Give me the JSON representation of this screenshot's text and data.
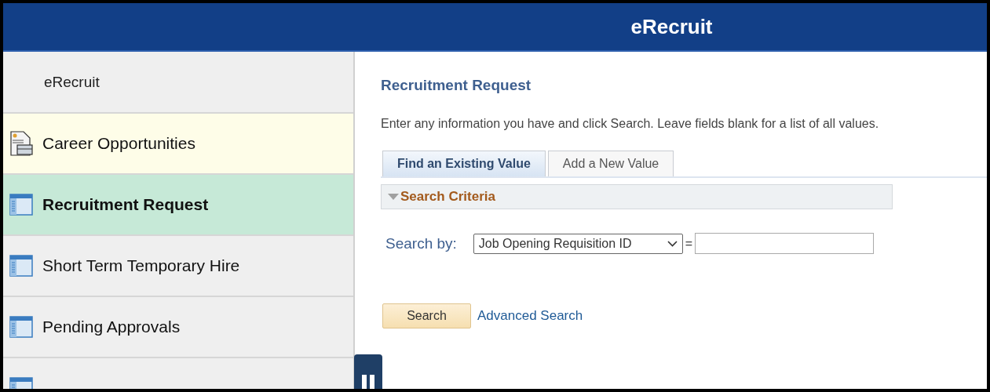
{
  "header": {
    "title": "eRecruit"
  },
  "sidebar": {
    "items": [
      {
        "kind": "heading",
        "label": "eRecruit",
        "selected": false
      },
      {
        "kind": "briefcase",
        "label": "Career Opportunities",
        "selected": false,
        "color": "#fefde8"
      },
      {
        "kind": "page",
        "label": "Recruitment Request",
        "selected": true
      },
      {
        "kind": "page",
        "label": "Short Term Temporary Hire",
        "selected": false
      },
      {
        "kind": "page",
        "label": "Pending Approvals",
        "selected": false
      },
      {
        "kind": "page",
        "selected": false
      }
    ]
  },
  "content": {
    "title": "Recruitment Request",
    "instructions": "Enter any information you have and click Search. Leave fields blank for a list of all values.",
    "tabs": [
      {
        "label": "Find an Existing Value",
        "selected": true
      },
      {
        "label": "Add a New Value",
        "selected": false
      }
    ],
    "section": {
      "title": "Search Criteria",
      "expanded": true
    },
    "search_by": {
      "label": "Search by:",
      "option": "Job Opening Requisition ID",
      "operator": "="
    },
    "buttons": {
      "search": "Search",
      "advanced": "Advanced Search"
    }
  }
}
